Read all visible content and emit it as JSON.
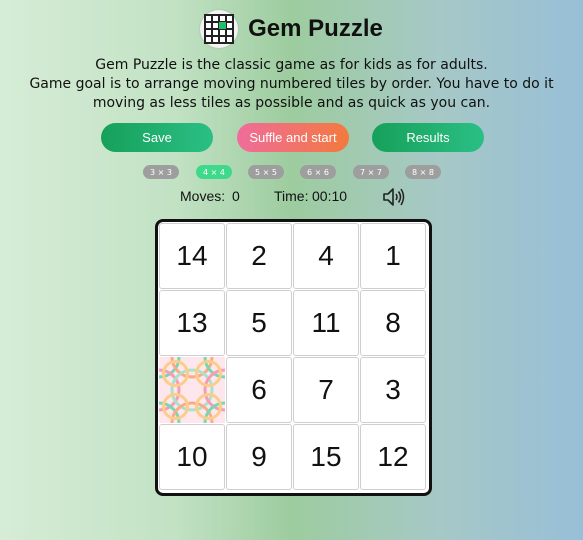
{
  "header": {
    "title": "Gem Puzzle",
    "logo_icon": "grid-puzzle-icon"
  },
  "description": {
    "line1": "Gem Puzzle is the classic game as for kids as for adults.",
    "line2": "Game goal is to arrange moving numbered tiles by order. You have to do it",
    "line3": "moving as less tiles as possible and as quick as you can."
  },
  "buttons": {
    "save": "Save",
    "shuffle": "Suffle and start",
    "results": "Results"
  },
  "sizes": {
    "items": [
      "3 × 3",
      "4 × 4",
      "5 × 5",
      "6 × 6",
      "7 × 7",
      "8 × 8"
    ],
    "selected": "4 × 4"
  },
  "status": {
    "moves_label": "Moves:",
    "moves": "0",
    "time_label": "Time:",
    "time": "00:10",
    "sound_icon": "speaker-icon"
  },
  "board": {
    "tiles": [
      [
        "14",
        "2",
        "4",
        "1"
      ],
      [
        "13",
        "5",
        "11",
        "8"
      ],
      [
        "",
        "6",
        "7",
        "3"
      ],
      [
        "10",
        "9",
        "15",
        "12"
      ]
    ]
  },
  "colors": {
    "accent_green": "#16a05a",
    "accent_pink": "#f06c9b",
    "accent_orange": "#f27a3e",
    "size_active": "#3ed98a",
    "size_inactive": "#9e9e9e"
  }
}
